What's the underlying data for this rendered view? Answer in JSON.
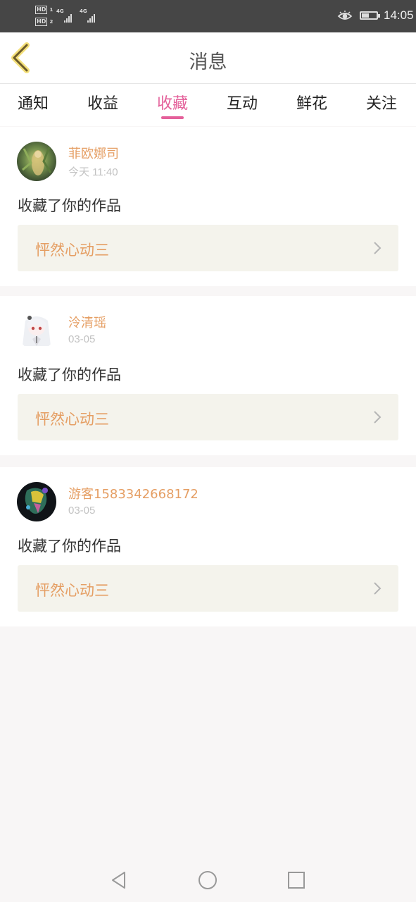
{
  "status_bar": {
    "time": "14:05",
    "hd_labels": [
      "HD",
      "HD"
    ],
    "sim_slots": [
      "1",
      "2"
    ],
    "network_labels": [
      "4G",
      "4G"
    ],
    "battery_level": 0.45,
    "icons": [
      "eye-icon",
      "battery-icon"
    ]
  },
  "header": {
    "title": "消息",
    "back_icon": "chevron-left-icon"
  },
  "tabs": {
    "items": [
      {
        "label": "通知"
      },
      {
        "label": "收益"
      },
      {
        "label": "收藏"
      },
      {
        "label": "互动"
      },
      {
        "label": "鲜花"
      },
      {
        "label": "关注"
      }
    ],
    "active_index": 2,
    "accent_color": "#e4609a"
  },
  "messages": [
    {
      "username": "菲欧娜司",
      "timestamp": "今天 11:40",
      "action": "收藏了你的作品",
      "work_title": "怦然心动三"
    },
    {
      "username": "泠清瑶",
      "timestamp": "03-05",
      "action": "收藏了你的作品",
      "work_title": "怦然心动三"
    },
    {
      "username": "游客1583342668172",
      "timestamp": "03-05",
      "action": "收藏了你的作品",
      "work_title": "怦然心动三"
    }
  ],
  "colors": {
    "username": "#e59e63",
    "work_card_bg": "#f4f3ec",
    "status_bar_bg": "#464646"
  },
  "nav_bar": {
    "icons": [
      "back-triangle-icon",
      "home-circle-icon",
      "recents-square-icon"
    ]
  }
}
